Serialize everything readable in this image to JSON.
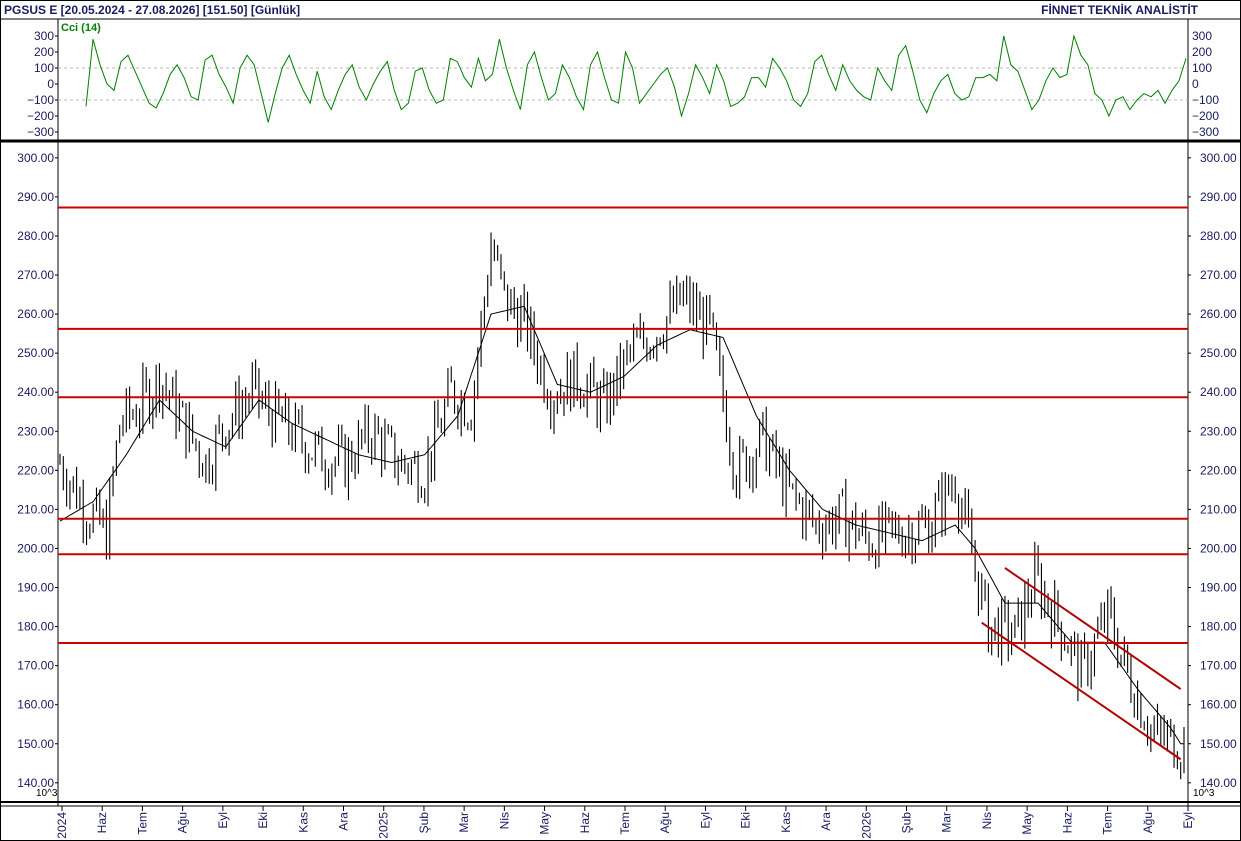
{
  "header": {
    "symbol_range": "PGSUS E  [20.05.2024 - 27.08.2026]  [151.50]  [Günlük]",
    "provider": "FİNNET TEKNİK ANALİSTİT"
  },
  "scale_label": "10^3",
  "colors": {
    "price": "#000000",
    "moving_average": "#000000",
    "cci": "#008000",
    "horizontal_levels": "#cc0000",
    "channel": "#b00000",
    "grid": "#b4b4b4",
    "text": "#1a1a60"
  },
  "chart_data": [
    {
      "type": "line",
      "name": "Cci (14)",
      "yticks": [
        -300,
        -200,
        -100,
        0,
        100,
        200,
        300
      ],
      "ylim": [
        -300,
        300
      ],
      "reference_lines": [
        100,
        -100
      ],
      "values": [
        -140,
        280,
        120,
        0,
        -40,
        140,
        180,
        80,
        -20,
        -120,
        -150,
        -60,
        60,
        120,
        40,
        -80,
        -100,
        150,
        180,
        60,
        -20,
        -120,
        100,
        180,
        120,
        -60,
        -240,
        -60,
        100,
        180,
        60,
        -40,
        -120,
        80,
        -80,
        -160,
        -40,
        60,
        120,
        -20,
        -100,
        0,
        80,
        140,
        -40,
        -160,
        -120,
        80,
        100,
        -40,
        -120,
        -100,
        160,
        140,
        40,
        -20,
        160,
        20,
        60,
        280,
        100,
        -40,
        -160,
        120,
        200,
        40,
        -100,
        -60,
        120,
        40,
        -80,
        -160,
        120,
        200,
        40,
        -100,
        -120,
        200,
        100,
        -120,
        -60,
        0,
        60,
        100,
        -20,
        -200,
        -60,
        120,
        40,
        -60,
        120,
        20,
        -140,
        -120,
        -80,
        40,
        40,
        -20,
        160,
        100,
        20,
        -100,
        -140,
        -60,
        140,
        180,
        60,
        -40,
        120,
        20,
        -40,
        -80,
        -100,
        100,
        20,
        -40,
        180,
        240,
        80,
        -100,
        -180,
        -60,
        20,
        60,
        -60,
        -100,
        -80,
        40,
        40,
        60,
        20,
        300,
        120,
        80,
        -40,
        -160,
        -100,
        20,
        100,
        40,
        60,
        300,
        180,
        120,
        -60,
        -100,
        -200,
        -100,
        -80,
        -160,
        -100,
        -60,
        -80,
        -40,
        -120,
        -40,
        20,
        160
      ]
    },
    {
      "type": "line",
      "name": "PGSUS E",
      "yticks": [
        140,
        150,
        160,
        170,
        180,
        190,
        200,
        210,
        220,
        230,
        240,
        250,
        260,
        270,
        280,
        290,
        300
      ],
      "ylim": [
        135.6,
        303.8
      ],
      "last_value": 151.5,
      "x_labels": [
        "2024",
        "Haz",
        "Tem",
        "Ağu",
        "Eyl",
        "Eki",
        "Kas",
        "Ara",
        "2025",
        "Şub",
        "Mar",
        "Nis",
        "May",
        "Haz",
        "Tem",
        "Ağu",
        "Eyl",
        "Eki",
        "Kas",
        "Ara",
        "2026",
        "Şub",
        "Mar",
        "Nis",
        "May",
        "Haz",
        "Tem",
        "Ağu",
        "Eyl"
      ],
      "close_anchors": [
        [
          0,
          222
        ],
        [
          8,
          210
        ],
        [
          14,
          204
        ],
        [
          18,
          232
        ],
        [
          24,
          236
        ],
        [
          30,
          244
        ],
        [
          36,
          234
        ],
        [
          44,
          222
        ],
        [
          50,
          232
        ],
        [
          58,
          240
        ],
        [
          64,
          234
        ],
        [
          70,
          230
        ],
        [
          78,
          224
        ],
        [
          86,
          222
        ],
        [
          94,
          230
        ],
        [
          102,
          222
        ],
        [
          110,
          220
        ],
        [
          118,
          240
        ],
        [
          124,
          236
        ],
        [
          130,
          278
        ],
        [
          134,
          264
        ],
        [
          140,
          258
        ],
        [
          148,
          240
        ],
        [
          156,
          244
        ],
        [
          164,
          236
        ],
        [
          172,
          250
        ],
        [
          180,
          256
        ],
        [
          188,
          264
        ],
        [
          196,
          256
        ],
        [
          204,
          220
        ],
        [
          212,
          228
        ],
        [
          220,
          214
        ],
        [
          228,
          206
        ],
        [
          236,
          208
        ],
        [
          244,
          202
        ],
        [
          252,
          204
        ],
        [
          262,
          206
        ],
        [
          270,
          218
        ],
        [
          274,
          202
        ],
        [
          280,
          180
        ],
        [
          288,
          178
        ],
        [
          294,
          192
        ],
        [
          302,
          180
        ],
        [
          308,
          168
        ],
        [
          316,
          183
        ],
        [
          322,
          168
        ],
        [
          330,
          152
        ],
        [
          338,
          150
        ]
      ],
      "moving_average_anchors": [
        [
          0,
          207
        ],
        [
          10,
          212
        ],
        [
          20,
          224
        ],
        [
          30,
          238
        ],
        [
          40,
          230
        ],
        [
          50,
          226
        ],
        [
          60,
          238
        ],
        [
          70,
          232
        ],
        [
          80,
          228
        ],
        [
          90,
          224
        ],
        [
          100,
          222
        ],
        [
          110,
          224
        ],
        [
          120,
          234
        ],
        [
          130,
          260
        ],
        [
          140,
          262
        ],
        [
          150,
          242
        ],
        [
          160,
          240
        ],
        [
          170,
          244
        ],
        [
          180,
          252
        ],
        [
          190,
          256
        ],
        [
          200,
          254
        ],
        [
          210,
          234
        ],
        [
          220,
          220
        ],
        [
          230,
          210
        ],
        [
          240,
          206
        ],
        [
          250,
          204
        ],
        [
          260,
          202
        ],
        [
          270,
          206
        ],
        [
          276,
          200
        ],
        [
          285,
          186
        ],
        [
          295,
          186
        ],
        [
          305,
          176
        ],
        [
          315,
          176
        ],
        [
          325,
          164
        ],
        [
          335,
          154
        ],
        [
          338,
          150
        ]
      ],
      "horizontal_levels": [
        287.3,
        256.2,
        238.7,
        207.6,
        198.5,
        175.8
      ],
      "channel_upper": [
        [
          285,
          195
        ],
        [
          338,
          164
        ]
      ],
      "channel_lower": [
        [
          278,
          181
        ],
        [
          338,
          146
        ]
      ]
    }
  ]
}
